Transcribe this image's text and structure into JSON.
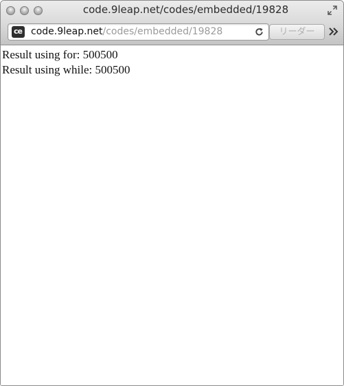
{
  "window": {
    "title": "code.9leap.net/codes/embedded/19828"
  },
  "toolbar": {
    "site_icon_text": "ce",
    "url_host": "code.9leap.net",
    "url_path": "/codes/embedded/19828",
    "reader_label": "リーダー"
  },
  "icons": {
    "close": "close-icon",
    "minimize": "minimize-icon",
    "zoom": "zoom-icon",
    "fullscreen": "fullscreen-icon",
    "reload": "reload-icon",
    "more": "chevron-double-right-icon",
    "site": "site-favicon"
  },
  "content": {
    "lines": [
      "Result using for: 500500",
      "Result using while: 500500"
    ]
  }
}
